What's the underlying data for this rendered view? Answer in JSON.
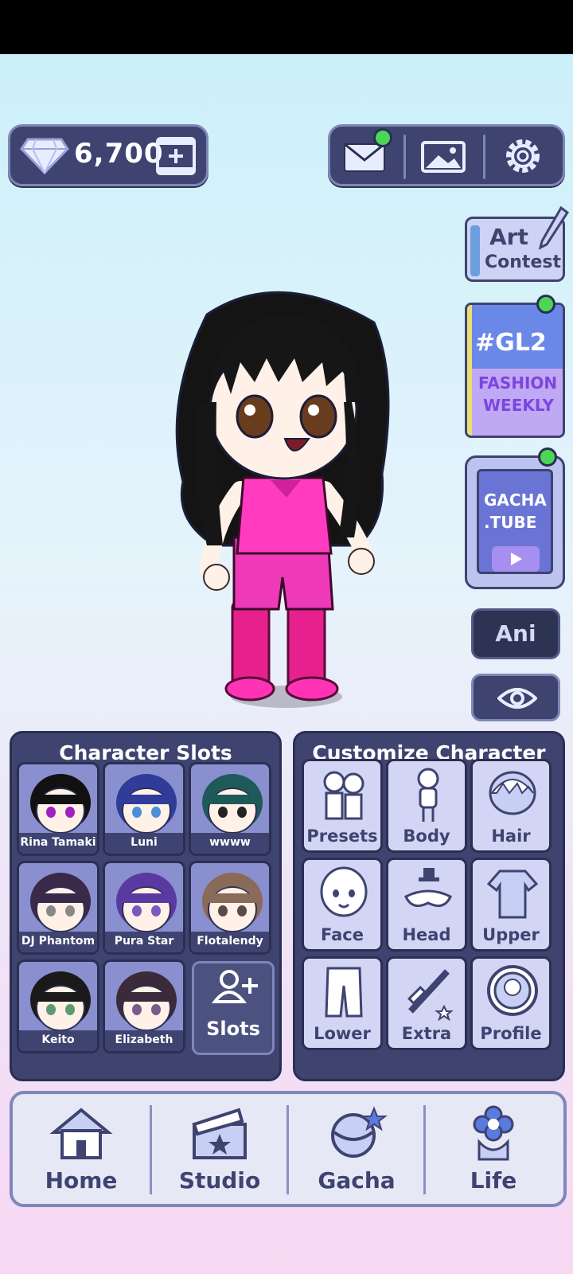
{
  "currency": {
    "gems": "6,700"
  },
  "top_tools": {
    "mail_icon": "mail-icon",
    "gallery_icon": "image-icon",
    "settings_icon": "gear-icon"
  },
  "side": {
    "art_line1": "Art",
    "art_line2": "Contest",
    "gl2_title": "#GL2",
    "gl2_line2": "FASHION",
    "gl2_line3": "WEEKLY",
    "tube_line1": "GACHA",
    "tube_line2": ".TUBE",
    "ani_label": "Ani"
  },
  "slots_panel": {
    "title": "Character Slots",
    "slots": [
      {
        "name": "Rina Tamaki",
        "hair": "#111111",
        "eye": "#a020c0",
        "bg": "#8a8fd0"
      },
      {
        "name": "Luni",
        "hair": "#2f3c9a",
        "eye": "#4a90d8",
        "bg": "#8a8fd0"
      },
      {
        "name": "wwww",
        "hair": "#1f5a5a",
        "eye": "#222222",
        "bg": "#8a8fd0"
      },
      {
        "name": "DJ Phantom",
        "hair": "#3a2a4a",
        "eye": "#888888",
        "bg": "#8a8fd0"
      },
      {
        "name": "Pura Star",
        "hair": "#5a3aa0",
        "eye": "#7a58c0",
        "bg": "#8a8fd0"
      },
      {
        "name": "Flotalendy",
        "hair": "#8a6a58",
        "eye": "#5a4a48",
        "bg": "#8a8fd0"
      },
      {
        "name": "Keito",
        "hair": "#1a1a1a",
        "eye": "#5a9a70",
        "bg": "#8a8fd0"
      },
      {
        "name": "Elizabeth",
        "hair": "#3a2a3a",
        "eye": "#7a5a8a",
        "bg": "#8a8fd0"
      }
    ],
    "add_label": "Slots"
  },
  "customize_panel": {
    "title": "Customize Character",
    "categories": [
      {
        "label": "Presets",
        "icon": "presets-icon"
      },
      {
        "label": "Body",
        "icon": "body-icon"
      },
      {
        "label": "Hair",
        "icon": "hair-icon"
      },
      {
        "label": "Face",
        "icon": "face-icon"
      },
      {
        "label": "Head",
        "icon": "head-accessory-icon"
      },
      {
        "label": "Upper",
        "icon": "shirt-icon"
      },
      {
        "label": "Lower",
        "icon": "shorts-icon"
      },
      {
        "label": "Extra",
        "icon": "sword-icon"
      },
      {
        "label": "Profile",
        "icon": "profile-icon"
      }
    ]
  },
  "nav": {
    "items": [
      {
        "label": "Home",
        "icon": "house-icon"
      },
      {
        "label": "Studio",
        "icon": "clapperboard-icon"
      },
      {
        "label": "Gacha",
        "icon": "gacha-capsule-icon"
      },
      {
        "label": "Life",
        "icon": "flower-icon"
      }
    ]
  },
  "colors": {
    "panel": "#3e4370",
    "accent": "#7f86b8",
    "notify": "#4cd655",
    "outfit": "#e83ab8"
  }
}
